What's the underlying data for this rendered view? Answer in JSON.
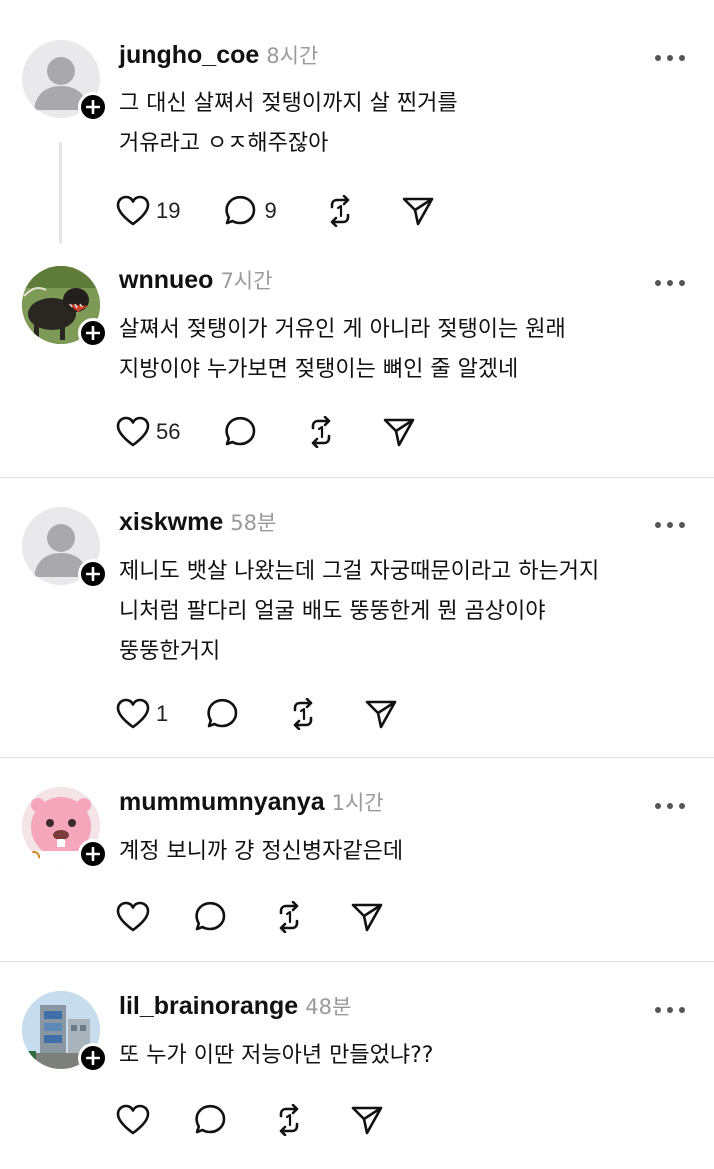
{
  "comments": [
    {
      "username": "jungho_coe",
      "time": "8시간",
      "lines": [
        "그 대신 살쪄서 젖탱이까지 살 찐거를",
        "거유라고 ㅇㅈ해주잖아"
      ],
      "likes": "19",
      "replies": "9",
      "avatar": "default-avatar"
    },
    {
      "username": "wnnueo",
      "time": "7시간",
      "lines": [
        "살쪄서 젖탱이가 거유인 게 아니라 젖탱이는 원래",
        "지방이야 누가보면 젖탱이는 뼈인 줄 알겠네"
      ],
      "likes": "56",
      "replies": "",
      "avatar": "dog-photo-avatar"
    },
    {
      "username": "xiskwme",
      "time": "58분",
      "lines": [
        "제니도 뱃살 나왔는데 그걸 자궁때문이라고 하는거지",
        "니처럼 팔다리 얼굴 배도 뚱뚱한게 뭔 곰상이야",
        "뚱뚱한거지"
      ],
      "likes": "1",
      "replies": "",
      "avatar": "default-avatar"
    },
    {
      "username": "mummumnyanya",
      "time": "1시간",
      "lines": [
        "계정 보니까 걍 정신병자같은데"
      ],
      "likes": "",
      "replies": "",
      "avatar": "pink-beaver-avatar"
    },
    {
      "username": "lil_brainorange",
      "time": "48분",
      "lines": [
        "또 누가 이딴 저능아년 만들었냐??"
      ],
      "likes": "",
      "replies": "",
      "avatar": "building-photo-avatar"
    }
  ],
  "icons": {
    "like": "heart-icon",
    "reply": "comment-icon",
    "repost": "repost-icon",
    "share": "send-icon",
    "more": "more-icon",
    "follow": "plus-icon"
  },
  "colors": {
    "text": "#111111",
    "muted": "#9a9a9a",
    "divider": "#e3e3e3",
    "badge": "#000000"
  }
}
